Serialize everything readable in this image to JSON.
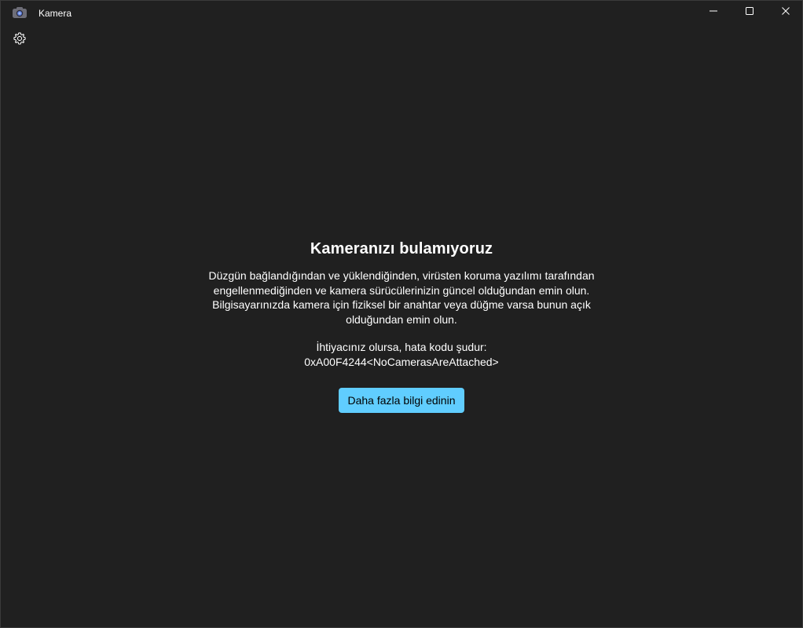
{
  "window": {
    "title": "Kamera",
    "icons": {
      "app": "camera-icon",
      "minimize": "minimize-icon",
      "maximize": "maximize-icon",
      "close": "close-icon",
      "settings": "gear-icon"
    }
  },
  "error": {
    "heading": "Kameranızı bulamıyoruz",
    "description_lines": [
      "Düzgün bağlandığından ve yüklendiğinden, virüsten koruma yazılımı tarafından",
      "engellenmediğinden ve kamera sürücülerinizin güncel olduğundan emin olun.",
      "Bilgisayarınızda kamera için fiziksel bir anahtar veya düğme varsa bunun açık",
      "olduğundan emin olun."
    ],
    "code_intro": "İhtiyacınız olursa, hata kodu şudur:",
    "code": "0xA00F4244<NoCamerasAreAttached>",
    "button_label": "Daha fazla bilgi edinin"
  },
  "colors": {
    "background": "#202020",
    "accent": "#60cdff"
  }
}
